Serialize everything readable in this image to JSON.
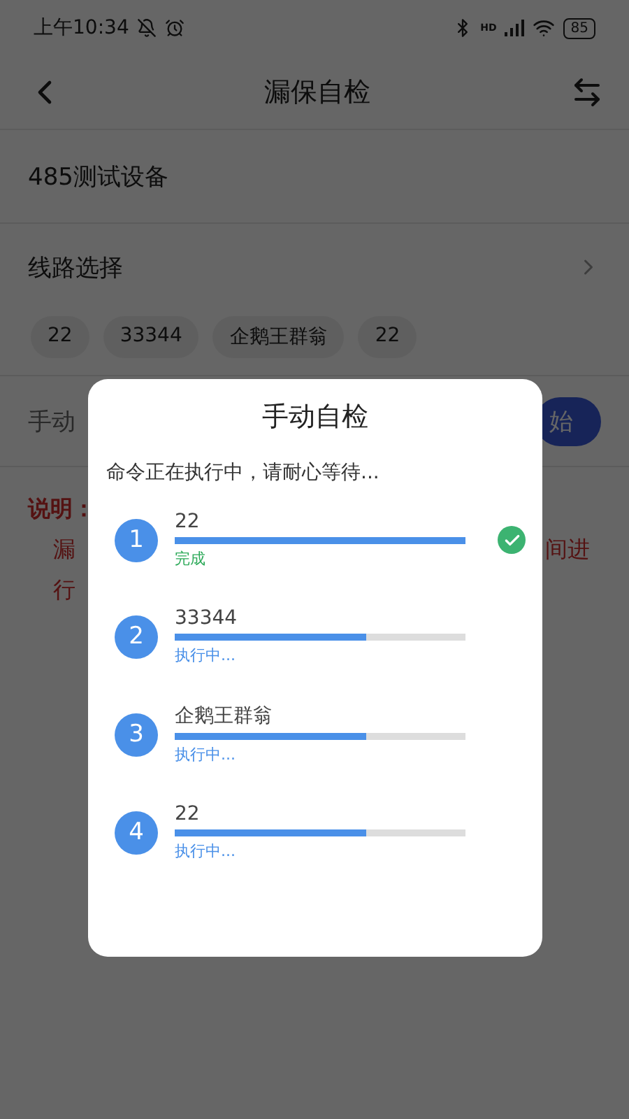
{
  "status_bar": {
    "time": "上午10:34",
    "battery": "85",
    "network_label": "HD"
  },
  "header": {
    "title": "漏保自检"
  },
  "device": {
    "name": "485测试设备"
  },
  "route": {
    "label": "线路选择"
  },
  "chips": [
    "22",
    "33344",
    "企鹅王群翁",
    "22"
  ],
  "manual": {
    "label": "手动",
    "button": "始"
  },
  "note": {
    "title": "说明：",
    "lines": [
      {
        "left": "漏",
        "right": "间进"
      },
      {
        "left": "行"
      }
    ]
  },
  "dialog": {
    "title": "手动自检",
    "message": "命令正在执行中，请耐心等待...",
    "items": [
      {
        "index": "1",
        "name": "22",
        "level": 1,
        "status": "完成",
        "kind": "done"
      },
      {
        "index": "2",
        "name": "33344",
        "level": 0.66,
        "status": "执行中...",
        "kind": "running"
      },
      {
        "index": "3",
        "name": "企鹅王群翁",
        "level": 0.66,
        "status": "执行中...",
        "kind": "running"
      },
      {
        "index": "4",
        "name": "22",
        "level": 0.66,
        "status": "执行中...",
        "kind": "running"
      }
    ]
  }
}
